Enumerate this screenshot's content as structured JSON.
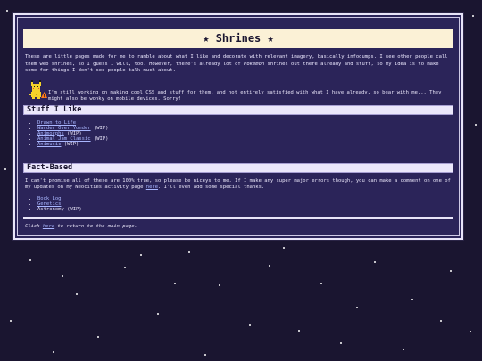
{
  "page": {
    "title": "Shrines",
    "title_star_left": "★",
    "title_star_right": "★",
    "intro_before_em": "These are little pages made for me to ramble about what I like and decorate with relevant imagery, basically infodumps. I see other people call them web shrines, so I guess I will, too. However, there's already lot of ",
    "intro_em": "Pokemon",
    "intro_after_em": " shrines out there already and stuff, so my idea is to make some for things I don't see people talk much about.",
    "wip_note": "I'm still working on making cool CSS and stuff for them, and not entirely satisfied with what I have already, so bear with me... They might also be wonky on mobile devices. Sorry!"
  },
  "sections": [
    {
      "header": "Stuff I Like",
      "items": [
        {
          "label": "Drawn to Life",
          "suffix": "",
          "link": true
        },
        {
          "label": "Wander Over Yonder",
          "suffix": " (WIP)",
          "link": true
        },
        {
          "label": "Animorphs",
          "suffix": " (WIP)",
          "link": true
        },
        {
          "label": "Animal Jam Classic",
          "suffix": " (WIP)",
          "link": true
        },
        {
          "label": "Animusic",
          "suffix": " (WIP)",
          "link": true
        }
      ]
    },
    {
      "header": "Fact-Based",
      "text_before_link": "I can't promise all of these are 100% true, so please be niceys to me. If I make any super major errors though, you can make a comment on one of my updates on my Neocities activity page ",
      "text_link": "here",
      "text_after_link": ". I'll even add some special thanks.",
      "items": [
        {
          "label": "Book Log",
          "suffix": "",
          "link": true
        },
        {
          "label": "Genetics",
          "suffix": "",
          "link": true
        },
        {
          "label": "Astronomy",
          "suffix": " (WIP)",
          "link": false
        }
      ]
    }
  ],
  "footer": {
    "before": "Click ",
    "link": "here",
    "after": " to return to the main page."
  },
  "colors": {
    "background": "#1a1530",
    "panel": "#2b2459",
    "title_bar": "#fbf1d6",
    "link": "#a9b6ff"
  },
  "icons": {
    "mascot": "pikachu-sprite-icon",
    "warning": "warning-sign-icon"
  }
}
